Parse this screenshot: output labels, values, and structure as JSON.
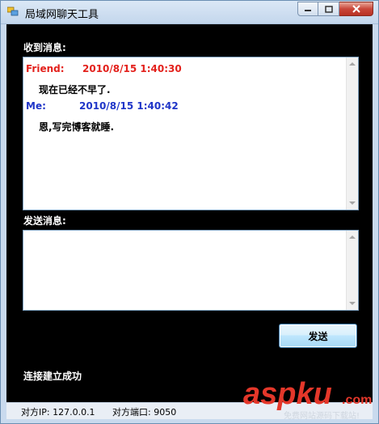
{
  "window": {
    "title": "局域网聊天工具"
  },
  "received": {
    "label": "收到消息:",
    "messages": [
      {
        "sender": "Friend:",
        "time": "2010/8/15 1:40:30",
        "text": "现在已经不早了.",
        "color": "#e3211c"
      },
      {
        "sender": "Me:",
        "time": "2010/8/15 1:40:42",
        "text": "恩,写完博客就睡.",
        "color": "#1f35c8"
      }
    ]
  },
  "send": {
    "label": "发送消息:",
    "input_value": "",
    "button_label": "发送"
  },
  "status": {
    "connection": "连接建立成功",
    "peer_ip": "对方IP: 127.0.0.1",
    "peer_port": "对方端口: 9050"
  },
  "watermark": {
    "brand": "aspku",
    "tld": ".com",
    "caption": "免费网站源码下载站!"
  },
  "colors": {
    "background": "#000000",
    "friend": "#e3211c",
    "me": "#1f35c8",
    "watermark": "#e4372a"
  }
}
